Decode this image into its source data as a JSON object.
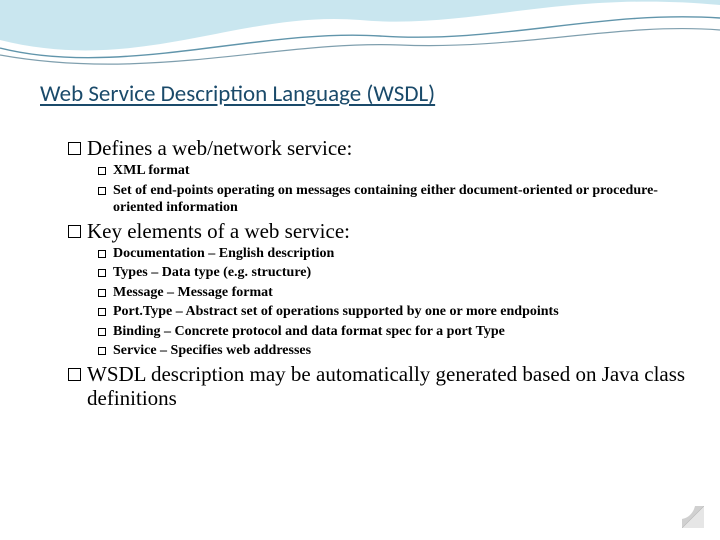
{
  "title": "Web Service Description Language (WSDL)",
  "sections": [
    {
      "heading": "Defines a web/network service:",
      "items": [
        "XML format",
        "Set of end-points operating on messages containing either document-oriented or procedure-oriented information"
      ]
    },
    {
      "heading": "Key elements of a web service:",
      "items": [
        "Documentation – English description",
        "Types – Data type (e.g. structure)",
        "Message – Message format",
        "Port.Type – Abstract set of operations supported by one or more endpoints",
        "Binding – Concrete protocol and data format spec for a port Type",
        "Service – Specifies web addresses"
      ]
    },
    {
      "heading": "WSDL description may be automatically generated based on Java class definitions",
      "items": []
    }
  ]
}
